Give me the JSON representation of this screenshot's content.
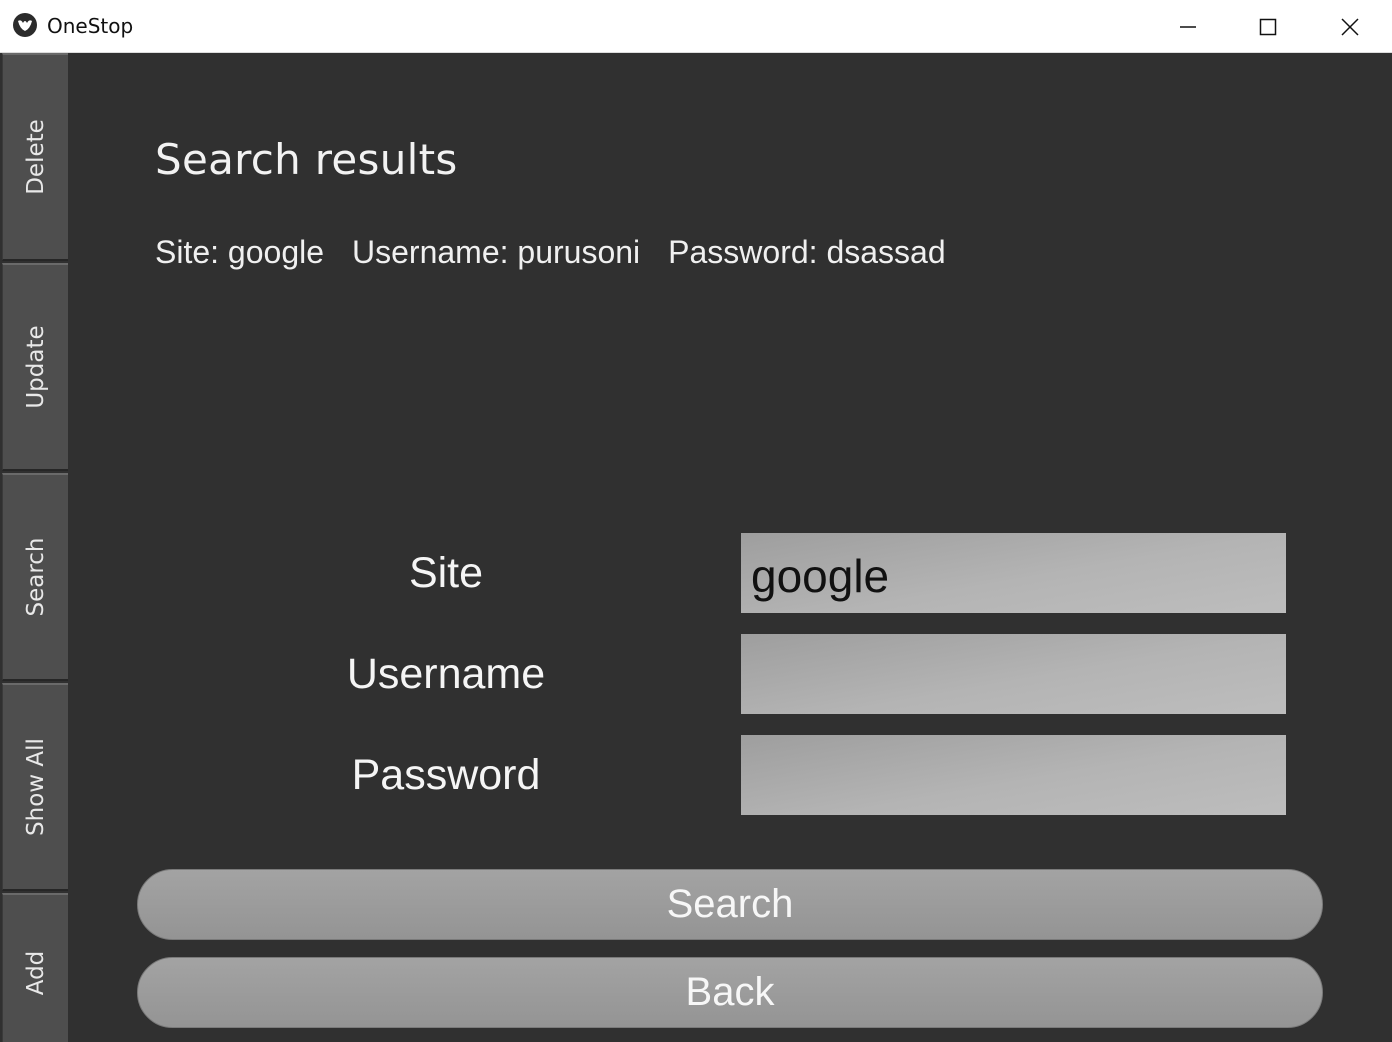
{
  "window": {
    "title": "OneStop",
    "controls": [
      "minimize-icon",
      "maximize-icon",
      "close-icon"
    ]
  },
  "sidebar": {
    "tabs": [
      {
        "label": "Delete"
      },
      {
        "label": "Update"
      },
      {
        "label": "Search"
      },
      {
        "label": "Show All"
      },
      {
        "label": "Add"
      }
    ]
  },
  "main": {
    "heading": "Search results",
    "result": {
      "site": "Site: google",
      "username": "Username: purusoni",
      "password": "Password: dsassad"
    },
    "form": {
      "site_label": "Site",
      "site_value": "google",
      "username_label": "Username",
      "username_value": "",
      "password_label": "Password",
      "password_value": ""
    },
    "buttons": {
      "search": "Search",
      "back": "Back"
    }
  },
  "colors": {
    "background": "#303030",
    "tab": "#4e4e4e",
    "field": "#b4b4b4",
    "button": "#9a9a9a"
  }
}
